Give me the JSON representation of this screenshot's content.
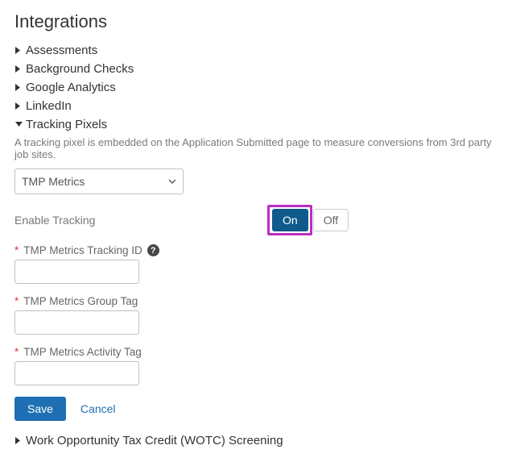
{
  "page": {
    "title": "Integrations"
  },
  "sections": {
    "assessments": {
      "label": "Assessments"
    },
    "background_checks": {
      "label": "Background Checks"
    },
    "google_analytics": {
      "label": "Google Analytics"
    },
    "linkedin": {
      "label": "LinkedIn"
    },
    "tracking_pixels": {
      "label": "Tracking Pixels",
      "description": "A tracking pixel is embedded on the Application Submitted page to measure conversions from 3rd party job sites.",
      "provider_selected": "TMP Metrics",
      "enable_tracking_label": "Enable Tracking",
      "toggle": {
        "on": "On",
        "off": "Off",
        "value": "On"
      },
      "fields": {
        "tracking_id": {
          "label": "TMP Metrics Tracking ID",
          "value": ""
        },
        "group_tag": {
          "label": "TMP Metrics Group Tag",
          "value": ""
        },
        "activity_tag": {
          "label": "TMP Metrics Activity Tag",
          "value": ""
        }
      },
      "actions": {
        "save": "Save",
        "cancel": "Cancel"
      }
    },
    "wotc": {
      "label": "Work Opportunity Tax Credit (WOTC) Screening"
    }
  }
}
